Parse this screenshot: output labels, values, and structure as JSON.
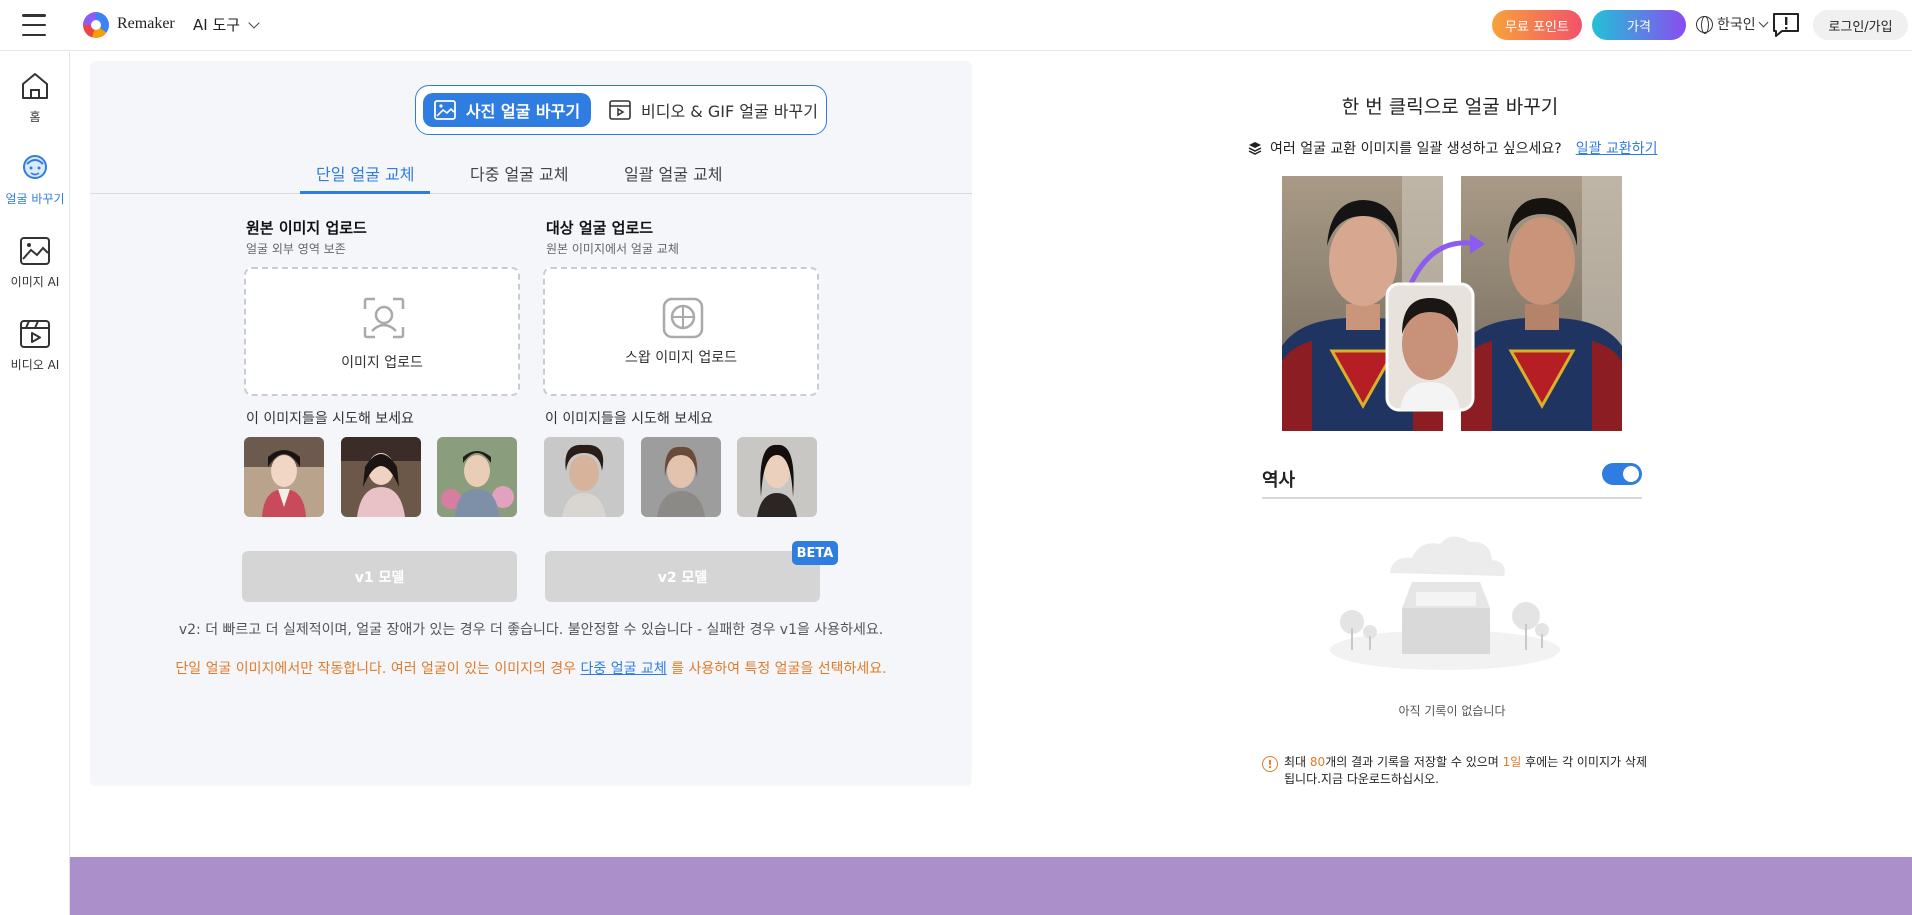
{
  "header": {
    "brand": "Remaker",
    "ai_tools": "AI 도구",
    "free_points": "무료 포인트",
    "price": "가격",
    "language": "한국인",
    "login": "로그인/가입",
    "colors": {
      "accent": "#2f7de1",
      "free": "#f2536a",
      "price": "#8a4cf0"
    }
  },
  "sidebar": {
    "items": [
      {
        "label": "홈",
        "icon": "home-icon"
      },
      {
        "label": "얼굴 바꾸기",
        "icon": "face-swap-icon",
        "active": true
      },
      {
        "label": "이미지 AI",
        "icon": "image-icon"
      },
      {
        "label": "비디오 AI",
        "icon": "video-icon"
      }
    ]
  },
  "main": {
    "mode_photo": "사진 얼굴 바꾸기",
    "mode_video": "비디오 & GIF 얼굴 바꾸기",
    "tabs": [
      "단일 얼굴 교체",
      "다중 얼굴 교체",
      "일괄 얼굴 교체"
    ],
    "source": {
      "title": "원본 이미지 업로드",
      "subtitle": "얼굴 외부 영역 보존",
      "upload_label": "이미지 업로드",
      "try_label": "이 이미지들을 시도해 보세요"
    },
    "target": {
      "title": "대상 얼굴 업로드",
      "subtitle": "원본 이미지에서 얼굴 교체",
      "upload_label": "스왑 이미지 업로드",
      "try_label": "이 이미지들을 시도해 보세요"
    },
    "v1_button": "v1 모델",
    "v2_button": "v2 모델",
    "beta": "BETA",
    "note_v2": "v2: 더 빠르고 더 실제적이며, 얼굴 장애가 있는 경우 더 좋습니다. 불안정할 수 있습니다 - 실패한 경우 v1을 사용하세요.",
    "note_single_before": "단일 얼굴 이미지에서만 작동합니다. 여러 얼굴이 있는 이미지의 경우 ",
    "note_single_link": "다중 얼굴 교체",
    "note_single_after": " 를 사용하여 특정 얼굴을 선택하세요."
  },
  "right": {
    "title": "한 번 클릭으로 얼굴 바꾸기",
    "batch_question": "여러 얼굴 교환 이미지를 일괄 생성하고 싶으세요?",
    "batch_link": "일괄 교환하기",
    "history_label": "역사",
    "history_toggle_on": true,
    "empty_text": "아직 기록이 없습니다",
    "warn_a": "최대 ",
    "warn_count": "80",
    "warn_b": "개의 결과 기록을 저장할 수 있으며 ",
    "warn_days": "1일",
    "warn_c": " 후에는 각 이미지가 삭제됩니다.지금 다운로드하십시오."
  }
}
